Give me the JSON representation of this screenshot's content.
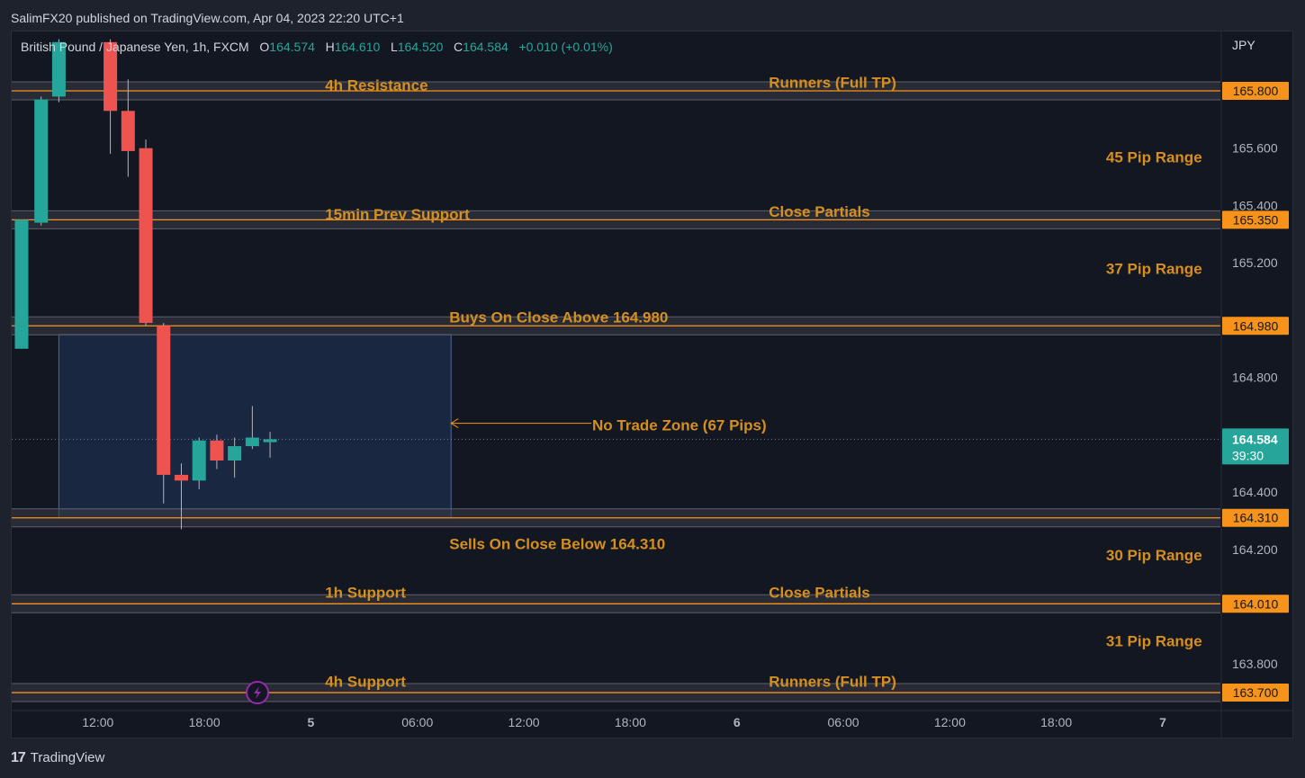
{
  "header": {
    "published_line": "SalimFX20 published on TradingView.com, Apr 04, 2023 22:20 UTC+1"
  },
  "symbol_bar": {
    "name": "British Pound / Japanese Yen, 1h, FXCM",
    "o_label": "O",
    "o_value": "164.574",
    "h_label": "H",
    "h_value": "164.610",
    "l_label": "L",
    "l_value": "164.520",
    "c_label": "C",
    "c_value": "164.584",
    "change": "+0.010 (+0.01%)"
  },
  "currency": "JPY",
  "footer": {
    "logo_glyph": "17",
    "brand": "TradingView"
  },
  "colors": {
    "up": "#26a69a",
    "down": "#ef5350",
    "level_line": "#f7931a",
    "label_text": "#d68f1d",
    "zone_fill": "#1b2a47",
    "zone_border": "#3d68c4",
    "price_badge": "#f7931a",
    "last_price_badge": "#26a69a",
    "alert_icon": "#9c27b0"
  },
  "chart_data": {
    "type": "candlestick",
    "symbol": "GBPJPY",
    "timeframe": "1h",
    "ylim": [
      163.6,
      165.95
    ],
    "y_ticks": [
      165.6,
      165.4,
      165.2,
      164.8,
      164.4,
      164.2,
      163.8
    ],
    "x_range": [
      0,
      82
    ],
    "x_ticks": [
      {
        "x": 4,
        "label": "12:00",
        "bold": false
      },
      {
        "x": 10,
        "label": "18:00",
        "bold": false
      },
      {
        "x": 16,
        "label": "5",
        "bold": true
      },
      {
        "x": 22,
        "label": "06:00",
        "bold": false
      },
      {
        "x": 28,
        "label": "12:00",
        "bold": false
      },
      {
        "x": 34,
        "label": "18:00",
        "bold": false
      },
      {
        "x": 40,
        "label": "6",
        "bold": true
      },
      {
        "x": 46,
        "label": "06:00",
        "bold": false
      },
      {
        "x": 52,
        "label": "12:00",
        "bold": false
      },
      {
        "x": 58,
        "label": "18:00",
        "bold": false
      },
      {
        "x": 64,
        "label": "7",
        "bold": true
      }
    ],
    "candles": [
      {
        "x": -0.3,
        "o": 164.9,
        "h": 165.35,
        "l": 164.9,
        "c": 165.35
      },
      {
        "x": 0.8,
        "o": 165.34,
        "h": 165.78,
        "l": 165.33,
        "c": 165.77
      },
      {
        "x": 1.8,
        "o": 165.78,
        "h": 165.98,
        "l": 165.76,
        "c": 165.97
      },
      {
        "x": 4.7,
        "o": 165.97,
        "h": 165.98,
        "l": 165.58,
        "c": 165.73
      },
      {
        "x": 5.7,
        "o": 165.73,
        "h": 165.84,
        "l": 165.5,
        "c": 165.59
      },
      {
        "x": 6.7,
        "o": 165.6,
        "h": 165.63,
        "l": 164.98,
        "c": 164.99
      },
      {
        "x": 7.7,
        "o": 164.98,
        "h": 164.99,
        "l": 164.36,
        "c": 164.46
      },
      {
        "x": 8.7,
        "o": 164.46,
        "h": 164.5,
        "l": 164.27,
        "c": 164.44
      },
      {
        "x": 9.7,
        "o": 164.44,
        "h": 164.59,
        "l": 164.41,
        "c": 164.58
      },
      {
        "x": 10.7,
        "o": 164.58,
        "h": 164.6,
        "l": 164.48,
        "c": 164.51
      },
      {
        "x": 11.7,
        "o": 164.51,
        "h": 164.59,
        "l": 164.45,
        "c": 164.56
      },
      {
        "x": 12.7,
        "o": 164.56,
        "h": 164.7,
        "l": 164.55,
        "c": 164.59
      },
      {
        "x": 13.7,
        "o": 164.574,
        "h": 164.61,
        "l": 164.52,
        "c": 164.584
      }
    ],
    "last_price": {
      "value": "164.584",
      "countdown": "39:30"
    },
    "levels": [
      {
        "price": 165.8,
        "badge": "165.800"
      },
      {
        "price": 165.35,
        "badge": "165.350"
      },
      {
        "price": 164.98,
        "badge": "164.980"
      },
      {
        "price": 164.31,
        "badge": "164.310"
      },
      {
        "price": 164.01,
        "badge": "164.010"
      },
      {
        "price": 163.7,
        "badge": "163.700"
      }
    ],
    "zone": {
      "x0": 1.8,
      "x1": 23.9,
      "y0": 164.31,
      "y1": 164.95,
      "label": "No Trade Zone (67 Pips)"
    },
    "annotations": [
      {
        "text": "4h Resistance",
        "x": 16.8,
        "y": 165.82
      },
      {
        "text": "Runners (Full TP)",
        "x": 41.8,
        "y": 165.83
      },
      {
        "text": "45 Pip Range",
        "x": 60.8,
        "y": 165.57
      },
      {
        "text": "15min Prev Support",
        "x": 16.8,
        "y": 165.37
      },
      {
        "text": "Close Partials",
        "x": 41.8,
        "y": 165.38
      },
      {
        "text": "37 Pip Range",
        "x": 60.8,
        "y": 165.18
      },
      {
        "text": "Buys On Close Above 164.980",
        "x": 23.8,
        "y": 165.01
      },
      {
        "text": "Sells On Close Below 164.310",
        "x": 23.8,
        "y": 164.22
      },
      {
        "text": "30 Pip Range",
        "x": 60.8,
        "y": 164.18
      },
      {
        "text": "1h Support",
        "x": 16.8,
        "y": 164.05
      },
      {
        "text": "Close Partials",
        "x": 41.8,
        "y": 164.05
      },
      {
        "text": "31 Pip Range",
        "x": 60.8,
        "y": 163.88
      },
      {
        "text": "4h Support",
        "x": 16.8,
        "y": 163.74
      },
      {
        "text": "Runners (Full TP)",
        "x": 41.8,
        "y": 163.74
      }
    ]
  }
}
